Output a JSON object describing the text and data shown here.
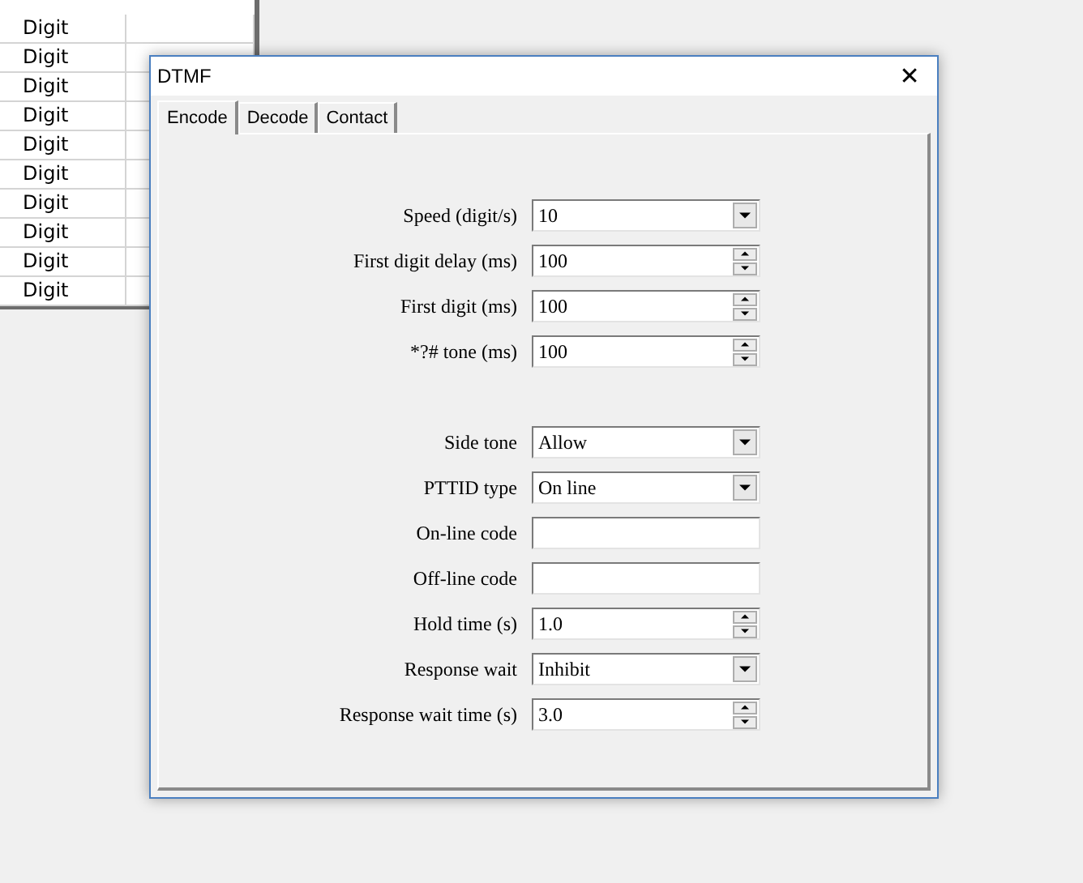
{
  "background_table": {
    "rows": [
      {
        "column_1": "Digit"
      },
      {
        "column_1": "Digit"
      },
      {
        "column_1": "Digit"
      },
      {
        "column_1": "Digit"
      },
      {
        "column_1": "Digit"
      },
      {
        "column_1": "Digit"
      },
      {
        "column_1": "Digit"
      },
      {
        "column_1": "Digit"
      },
      {
        "column_1": "Digit"
      },
      {
        "column_1": "Digit"
      }
    ]
  },
  "window": {
    "title": "DTMF",
    "close": "✕"
  },
  "tabs": [
    {
      "label": "Encode",
      "selected": true
    },
    {
      "label": "Decode",
      "selected": false
    },
    {
      "label": "Contact",
      "selected": false
    }
  ],
  "groups": [
    {
      "fields": [
        {
          "label": "Speed (digit/s)",
          "kind": "dropdown",
          "value": "10"
        },
        {
          "label": "First digit delay (ms)",
          "kind": "spinner",
          "value": "100"
        },
        {
          "label": "First digit (ms)",
          "kind": "spinner",
          "value": "100"
        },
        {
          "label": "*?# tone (ms)",
          "kind": "spinner",
          "value": "100"
        }
      ]
    },
    {
      "fields": [
        {
          "label": "Side tone",
          "kind": "dropdown",
          "value": "Allow"
        },
        {
          "label": "PTTID type",
          "kind": "dropdown",
          "value": "On line"
        },
        {
          "label": "On-line code",
          "kind": "text"
        },
        {
          "label": "Off-line  code",
          "kind": "text"
        },
        {
          "label": "Hold time (s)",
          "kind": "spinner",
          "value": "1.0"
        },
        {
          "label": "Response wait",
          "kind": "dropdown",
          "value": "Inhibit"
        },
        {
          "label": "Response wait time (s)",
          "kind": "spinner",
          "value": "3.0"
        }
      ]
    }
  ]
}
